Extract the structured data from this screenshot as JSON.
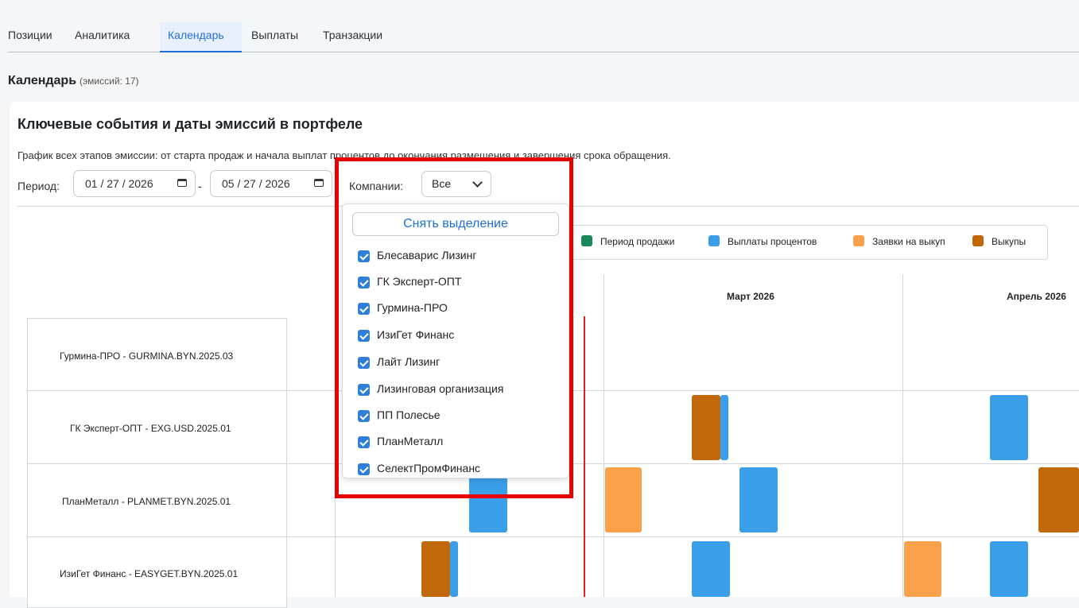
{
  "tabs": [
    {
      "label": "Позиции",
      "active": false
    },
    {
      "label": "Аналитика",
      "active": false
    },
    {
      "label": "Календарь",
      "active": true
    },
    {
      "label": "Выплаты",
      "active": false
    },
    {
      "label": "Транзакции",
      "active": false
    }
  ],
  "calendar": {
    "title": "Календарь",
    "count": "(эмиссий: 17)"
  },
  "card": {
    "title": "Ключевые события и даты эмиссий в портфеле",
    "description": "График всех этапов эмиссии: от старта продаж и начала выплат процентов до окончания размещения и завершения срока обращения."
  },
  "filters": {
    "period_label": "Период:",
    "date_from": "01 / 27 / 2026",
    "date_to": "05 / 27 / 2026",
    "dash": "-",
    "companies_label": "Компании:",
    "companies_value": "Все"
  },
  "legend": [
    {
      "label": "Период продажи",
      "color": "#1b8a5a"
    },
    {
      "label": "Выплаты процентов",
      "color": "#3a9ee8"
    },
    {
      "label": "Заявки на выкуп",
      "color": "#fba04b"
    },
    {
      "label": "Выкупы",
      "color": "#c0680a"
    }
  ],
  "months": [
    "Март 2026",
    "Апрель 2026"
  ],
  "rows": [
    {
      "label": "Гурмина-ПРО - GURMINA.BYN.2025.03"
    },
    {
      "label": "ГК Эксперт-ОПТ - EXG.USD.2025.01"
    },
    {
      "label": "ПланМеталл - PLANMET.BYN.2025.01"
    },
    {
      "label": "ИзиГет Финанс - EASYGET.BYN.2025.01"
    }
  ],
  "dropdown": {
    "clear_label": "Снять выделение",
    "options": [
      "Блесаварис Лизинг",
      "ГК Эксперт-ОПТ",
      "Гурмина-ПРО",
      "ИзиГет Финанс",
      "Лайт Лизинг",
      "Лизинговая организация",
      "ПП Полесье",
      "ПланМеталл",
      "СелектПромФинанс"
    ]
  },
  "colors": {
    "accent": "#1e6fd9",
    "sale": "#1b8a5a",
    "interest": "#3a9ee8",
    "request": "#fba04b",
    "buyback": "#c0680a",
    "today_line": "#e02020",
    "highlight": "#e60000"
  }
}
